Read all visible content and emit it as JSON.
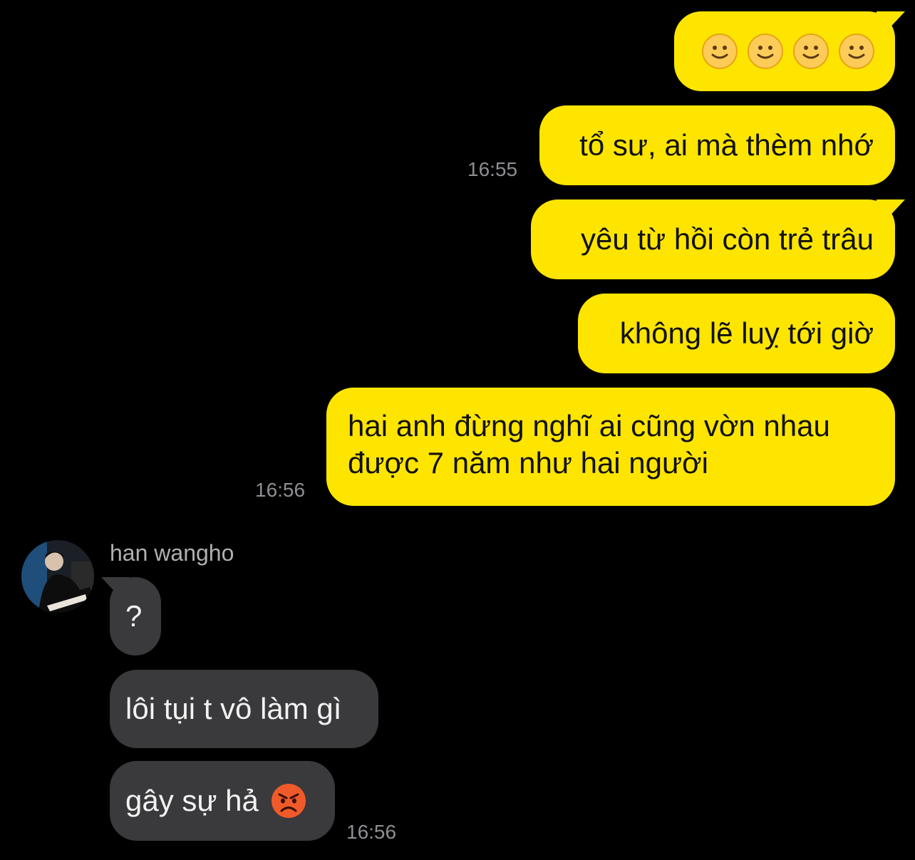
{
  "messages_out": [
    {
      "text": "🙂🙂🙂🙂",
      "faces": 4
    },
    {
      "text": "tổ sư, ai mà thèm nhớ",
      "time": "16:55"
    },
    {
      "text": "yêu từ hồi còn trẻ trâu"
    },
    {
      "text": "không lẽ luỵ tới giờ"
    },
    {
      "line1": "hai anh đừng nghĩ ai cũng vờn nhau",
      "line2": "được 7 năm như hai người",
      "time": "16:56"
    }
  ],
  "incoming": {
    "sender": "han wangho",
    "messages": [
      {
        "text": "?"
      },
      {
        "text": "lôi tụi t vô làm gì"
      },
      {
        "text": "gây sự hả",
        "emoji": "angry-face"
      }
    ],
    "time": "16:56"
  },
  "colors": {
    "outgoing_bubble": "#FEE500",
    "incoming_bubble": "#3a3a3c",
    "background": "#000000",
    "timestamp": "#8e8e93"
  }
}
